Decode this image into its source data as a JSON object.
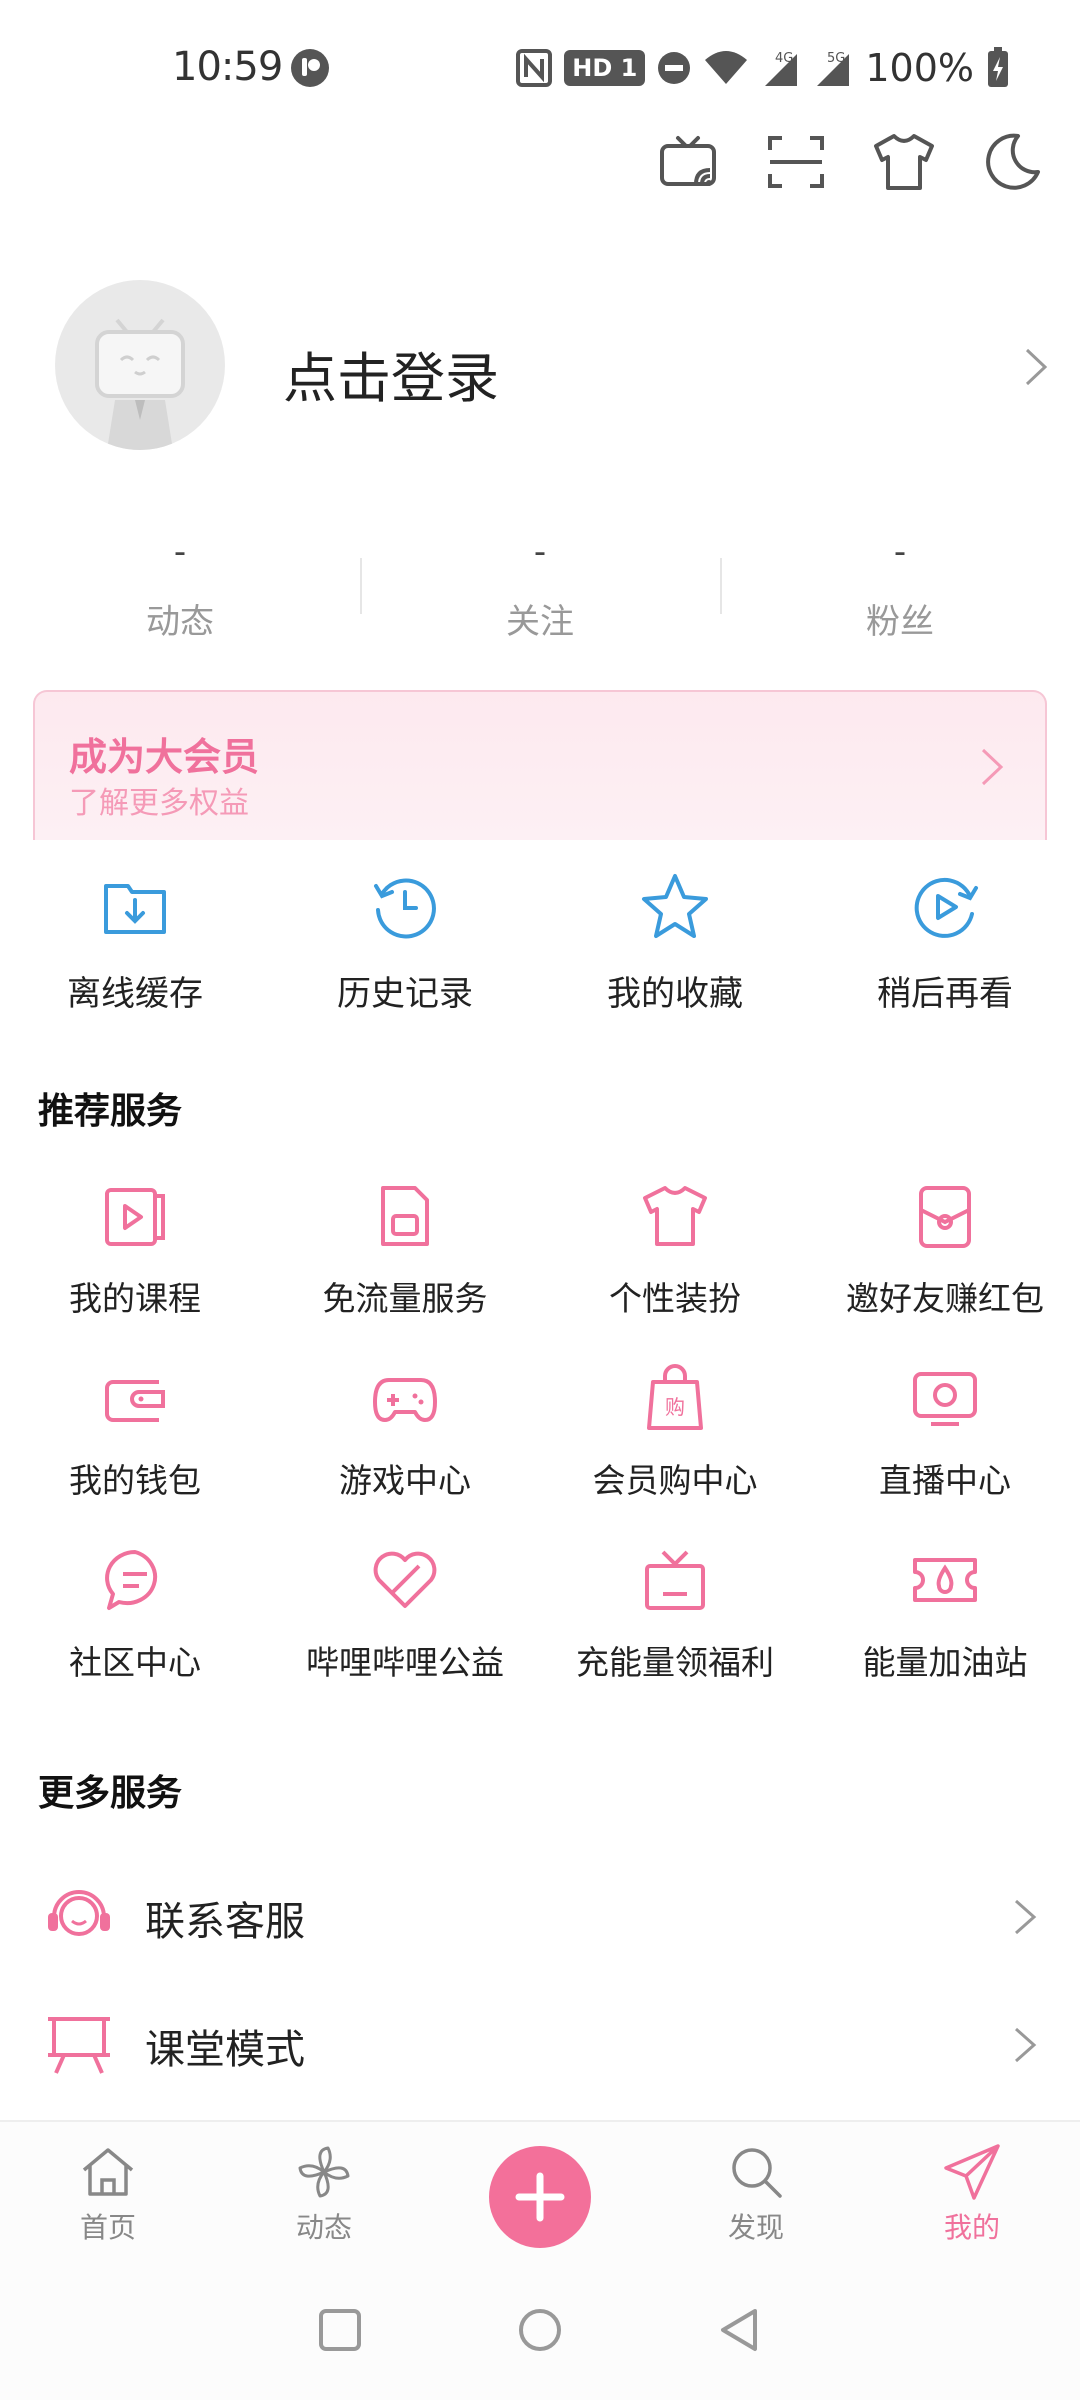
{
  "status_bar": {
    "time": "10:59",
    "hd_badge": "HD 1",
    "battery": "100%",
    "icons": [
      "nfc-icon",
      "do-not-disturb-icon",
      "wifi-icon",
      "signal-4g-icon",
      "signal-5g-icon",
      "battery-charging-icon"
    ]
  },
  "top_actions": [
    "tv-cast-icon",
    "scan-icon",
    "tshirt-icon",
    "moon-icon"
  ],
  "profile": {
    "login_label": "点击登录"
  },
  "stats": [
    {
      "value": "-",
      "label": "动态"
    },
    {
      "value": "-",
      "label": "关注"
    },
    {
      "value": "-",
      "label": "粉丝"
    }
  ],
  "vip": {
    "title": "成为大会员",
    "subtitle": "了解更多权益"
  },
  "quick": [
    {
      "label": "离线缓存",
      "icon": "download-folder-icon"
    },
    {
      "label": "历史记录",
      "icon": "history-icon"
    },
    {
      "label": "我的收藏",
      "icon": "star-icon"
    },
    {
      "label": "稍后再看",
      "icon": "watch-later-icon"
    }
  ],
  "recommended": {
    "title": "推荐服务",
    "items": [
      {
        "label": "我的课程",
        "icon": "course-icon"
      },
      {
        "label": "免流量服务",
        "icon": "sim-card-icon"
      },
      {
        "label": "个性装扮",
        "icon": "tshirt-icon"
      },
      {
        "label": "邀好友赚红包",
        "icon": "red-packet-icon"
      },
      {
        "label": "我的钱包",
        "icon": "wallet-icon"
      },
      {
        "label": "游戏中心",
        "icon": "gamepad-icon"
      },
      {
        "label": "会员购中心",
        "icon": "shopping-bag-icon"
      },
      {
        "label": "直播中心",
        "icon": "live-tv-icon"
      },
      {
        "label": "社区中心",
        "icon": "chat-bubble-icon"
      },
      {
        "label": "哔哩哔哩公益",
        "icon": "heart-bandage-icon"
      },
      {
        "label": "充能量领福利",
        "icon": "gift-box-icon"
      },
      {
        "label": "能量加油站",
        "icon": "energy-ticket-icon"
      }
    ]
  },
  "more": {
    "title": "更多服务",
    "items": [
      {
        "label": "联系客服",
        "icon": "headset-icon"
      },
      {
        "label": "课堂模式",
        "icon": "classroom-icon"
      }
    ]
  },
  "bottom_nav": [
    {
      "label": "首页",
      "icon": "home-icon"
    },
    {
      "label": "动态",
      "icon": "pinwheel-icon"
    },
    {
      "label": "",
      "icon": "plus-icon"
    },
    {
      "label": "发现",
      "icon": "search-icon"
    },
    {
      "label": "我的",
      "icon": "paper-plane-icon"
    }
  ],
  "colors": {
    "accent_pink": "#f0719c",
    "accent_blue": "#3a9bdc",
    "text_gray": "#999999"
  }
}
